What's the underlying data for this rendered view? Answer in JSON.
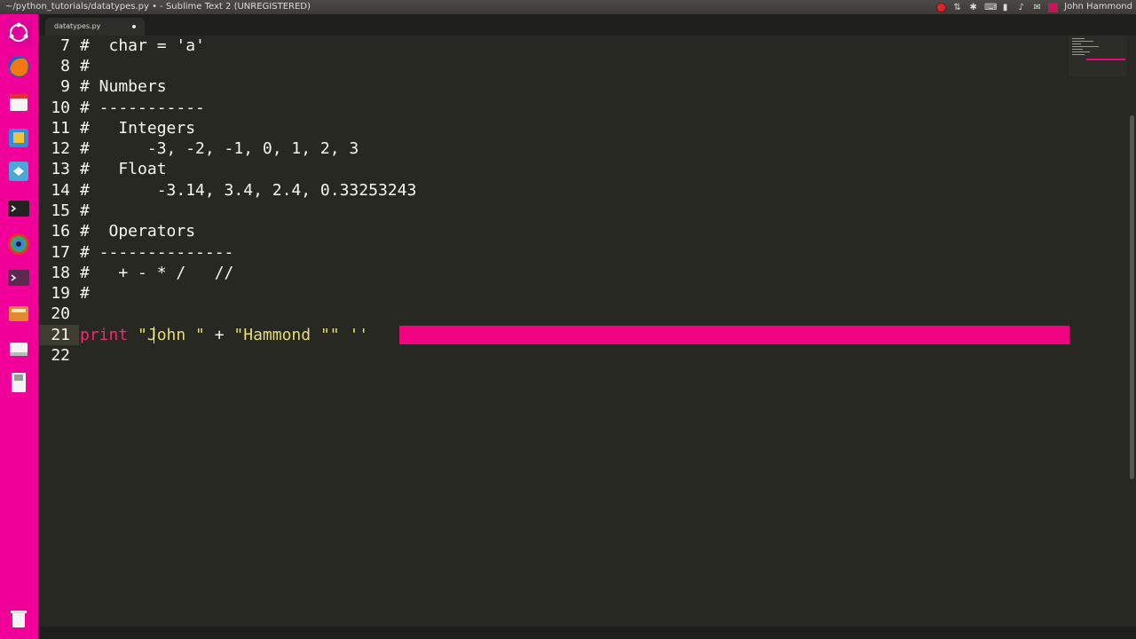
{
  "window": {
    "title": "~/python_tutorials/datatypes.py • - Sublime Text 2 (UNREGISTERED)"
  },
  "tray": {
    "user": "John Hammond",
    "icons": [
      "record-icon",
      "network-icon",
      "bluetooth-icon",
      "keyboard-icon",
      "battery-icon",
      "volume-icon",
      "mail-icon",
      "user-icon"
    ]
  },
  "launcher": {
    "icons": [
      "dash-icon",
      "firefox-icon",
      "files-icon",
      "software-center-icon",
      "sublime-text-icon",
      "terminal-icon",
      "color-picker-icon",
      "terminal-icon",
      "disk-icon",
      "removable-drive-icon",
      "floppy-icon",
      "trash-icon"
    ]
  },
  "tab": {
    "label": "datatypes.py"
  },
  "editor": {
    "lines": [
      {
        "num": "7",
        "text": "#  char = 'a'"
      },
      {
        "num": "8",
        "text": "#"
      },
      {
        "num": "9",
        "text": "# Numbers"
      },
      {
        "num": "10",
        "text": "# -----------"
      },
      {
        "num": "11",
        "text": "#   Integers"
      },
      {
        "num": "12",
        "text": "#      -3, -2, -1, 0, 1, 2, 3"
      },
      {
        "num": "13",
        "text": "#   Float"
      },
      {
        "num": "14",
        "text": "#       -3.14, 3.4, 2.4, 0.33253243"
      },
      {
        "num": "15",
        "text": "#"
      },
      {
        "num": "16",
        "text": "#  Operators"
      },
      {
        "num": "17",
        "text": "# --------------"
      },
      {
        "num": "18",
        "text": "#   + - * /   //"
      },
      {
        "num": "19",
        "text": "#"
      },
      {
        "num": "20",
        "text": ""
      },
      {
        "num": "21",
        "text": "print \"John \" + \"Hammond \"\" ''",
        "tokens": {
          "kw": "print",
          "s1": "\"John \"",
          "plus": " + ",
          "s2": "\"Hammond \"\"",
          "s3": " ''"
        }
      },
      {
        "num": "22",
        "text": ""
      }
    ],
    "current_line": "21"
  },
  "colors": {
    "background": "#272822",
    "launcher": "#f00098",
    "keyword": "#f92672",
    "string": "#e6db74",
    "error_highlight": "#f0047f"
  }
}
